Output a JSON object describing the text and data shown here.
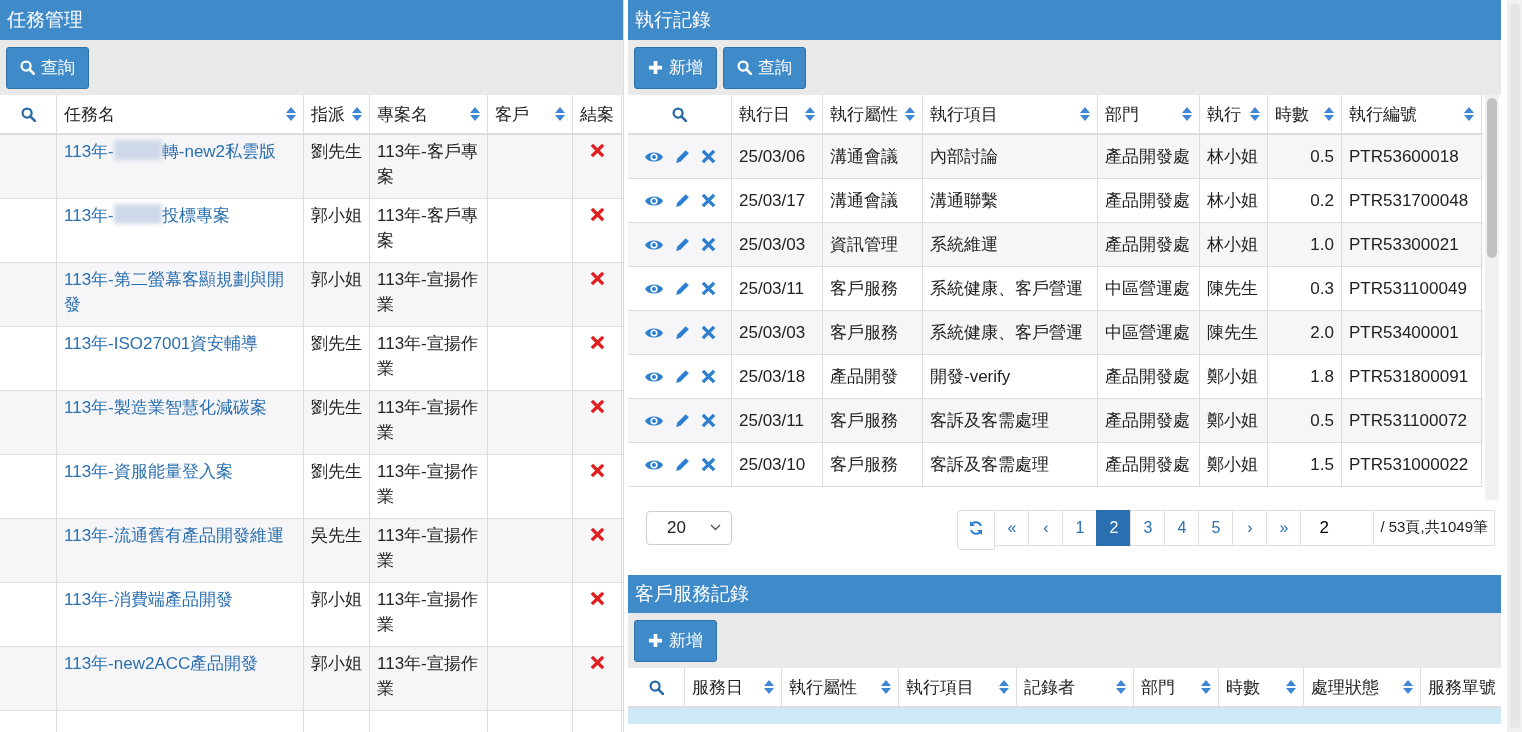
{
  "task_panel": {
    "title": "任務管理",
    "buttons": [
      {
        "kind": "search",
        "label": "查詢"
      }
    ],
    "columns": [
      {
        "label": "任務名",
        "sortable": true
      },
      {
        "label": "指派",
        "sortable": true
      },
      {
        "label": "專案名",
        "sortable": true
      },
      {
        "label": "客戶",
        "sortable": true
      },
      {
        "label": "結案",
        "sortable": false
      }
    ],
    "rows": [
      {
        "name_segments": [
          {
            "kind": "text",
            "text": "113年-"
          },
          {
            "kind": "blur"
          },
          {
            "kind": "text",
            "text": "轉-new2私雲版"
          }
        ],
        "assignee": "劉先生",
        "project": "113年-客戶專案",
        "closed": false
      },
      {
        "name_segments": [
          {
            "kind": "text",
            "text": "113年-"
          },
          {
            "kind": "blur"
          },
          {
            "kind": "text",
            "text": "投標專案"
          }
        ],
        "assignee": "郭小姐",
        "project": "113年-客戶專案",
        "closed": false
      },
      {
        "name_segments": [
          {
            "kind": "text",
            "text": "113年-第二螢幕客顯規劃與開發"
          }
        ],
        "assignee": "郭小姐",
        "project": "113年-宣揚作業",
        "closed": false
      },
      {
        "name_segments": [
          {
            "kind": "text",
            "text": "113年-ISO27001資安輔導"
          }
        ],
        "assignee": "劉先生",
        "project": "113年-宣揚作業",
        "closed": false
      },
      {
        "name_segments": [
          {
            "kind": "text",
            "text": "113年-製造業智慧化減碳案"
          }
        ],
        "assignee": "劉先生",
        "project": "113年-宣揚作業",
        "closed": false
      },
      {
        "name_segments": [
          {
            "kind": "text",
            "text": "113年-資服能量登入案"
          }
        ],
        "assignee": "劉先生",
        "project": "113年-宣揚作業",
        "closed": false
      },
      {
        "name_segments": [
          {
            "kind": "text",
            "text": "113年-流通舊有產品開發維運"
          }
        ],
        "assignee": "吳先生",
        "project": "113年-宣揚作業",
        "closed": false
      },
      {
        "name_segments": [
          {
            "kind": "text",
            "text": "113年-消費端產品開發"
          }
        ],
        "assignee": "郭小姐",
        "project": "113年-宣揚作業",
        "closed": false
      },
      {
        "name_segments": [
          {
            "kind": "text",
            "text": "113年-new2ACC產品開發"
          }
        ],
        "assignee": "郭小姐",
        "project": "113年-宣揚作業",
        "closed": false
      }
    ]
  },
  "execution_panel": {
    "title": "執行記錄",
    "buttons": [
      {
        "kind": "add",
        "label": "新增"
      },
      {
        "kind": "search",
        "label": "查詢"
      }
    ],
    "columns": [
      {
        "label": "執行日"
      },
      {
        "label": "執行屬性"
      },
      {
        "label": "執行項目"
      },
      {
        "label": "部門"
      },
      {
        "label": "執行"
      },
      {
        "label": "時數"
      },
      {
        "label": "執行編號"
      }
    ],
    "rows": [
      {
        "date": "25/03/06",
        "attribute": "溝通會議",
        "item": "內部討論",
        "department": "產品開發處",
        "executor": "林小姐",
        "hours": "0.5",
        "number": "PTR53600018"
      },
      {
        "date": "25/03/17",
        "attribute": "溝通會議",
        "item": "溝通聯繫",
        "department": "產品開發處",
        "executor": "林小姐",
        "hours": "0.2",
        "number": "PTR531700048"
      },
      {
        "date": "25/03/03",
        "attribute": "資訊管理",
        "item": "系統維運",
        "department": "產品開發處",
        "executor": "林小姐",
        "hours": "1.0",
        "number": "PTR53300021"
      },
      {
        "date": "25/03/11",
        "attribute": "客戶服務",
        "item": "系統健康、客戶營運",
        "department": "中區營運處",
        "executor": "陳先生",
        "hours": "0.3",
        "number": "PTR531100049"
      },
      {
        "date": "25/03/03",
        "attribute": "客戶服務",
        "item": "系統健康、客戶營運",
        "department": "中區營運處",
        "executor": "陳先生",
        "hours": "2.0",
        "number": "PTR53400001"
      },
      {
        "date": "25/03/18",
        "attribute": "產品開發",
        "item": "開發-verify",
        "department": "產品開發處",
        "executor": "鄭小姐",
        "hours": "1.8",
        "number": "PTR531800091"
      },
      {
        "date": "25/03/11",
        "attribute": "客戶服務",
        "item": "客訴及客需處理",
        "department": "產品開發處",
        "executor": "鄭小姐",
        "hours": "0.5",
        "number": "PTR531100072"
      },
      {
        "date": "25/03/10",
        "attribute": "客戶服務",
        "item": "客訴及客需處理",
        "department": "產品開發處",
        "executor": "鄭小姐",
        "hours": "1.5",
        "number": "PTR531000022"
      }
    ],
    "pagination": {
      "page_size": "20",
      "first": "«",
      "prev": "‹",
      "pages": [
        {
          "label": "1",
          "selected": false
        },
        {
          "label": "2",
          "selected": true
        },
        {
          "label": "3",
          "selected": false
        },
        {
          "label": "4",
          "selected": false
        },
        {
          "label": "5",
          "selected": false
        }
      ],
      "next": "›",
      "last": "»",
      "page_input": "2",
      "summary": "/ 53頁,共1049筆"
    }
  },
  "service_panel": {
    "title": "客戶服務記錄",
    "buttons": [
      {
        "kind": "add",
        "label": "新增"
      }
    ],
    "columns": [
      {
        "label": "服務日"
      },
      {
        "label": "執行屬性"
      },
      {
        "label": "執行項目"
      },
      {
        "label": "記錄者"
      },
      {
        "label": "部門"
      },
      {
        "label": "時數"
      },
      {
        "label": "處理狀態"
      },
      {
        "label": "服務單號"
      }
    ]
  }
}
